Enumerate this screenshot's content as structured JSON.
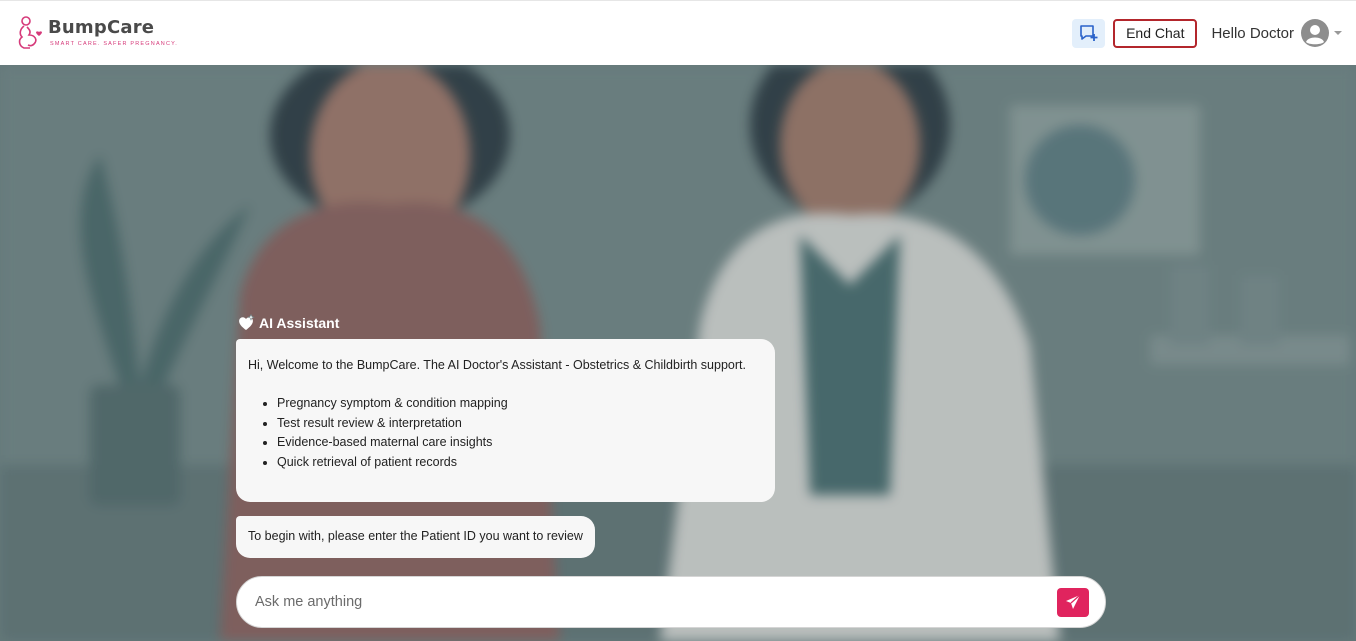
{
  "header": {
    "brand_name": "BumpCare",
    "brand_tagline": "SMART CARE. SAFER PREGNANCY.",
    "new_chat_icon": "chat-plus-icon",
    "end_chat_label": "End Chat",
    "greeting": "Hello Doctor",
    "avatar_icon": "user-avatar-icon"
  },
  "chat": {
    "assistant_label": "AI Assistant",
    "assistant_icon": "heart-sparkle-icon",
    "messages": [
      {
        "intro": "Hi, Welcome to the BumpCare. The AI Doctor's Assistant - Obstetrics & Childbirth support.",
        "bullets": [
          "Pregnancy symptom & condition mapping",
          "Test result review & interpretation",
          "Evidence-based maternal care insights",
          "Quick retrieval of patient records"
        ]
      },
      {
        "text": "To begin with, please enter the Patient ID you want to review"
      }
    ]
  },
  "composer": {
    "placeholder": "Ask me anything",
    "value": "",
    "send_icon": "send-icon"
  },
  "colors": {
    "brand_pink": "#e0245e",
    "end_chat_border": "#b3262c",
    "new_chat_bg": "#e3effb"
  }
}
